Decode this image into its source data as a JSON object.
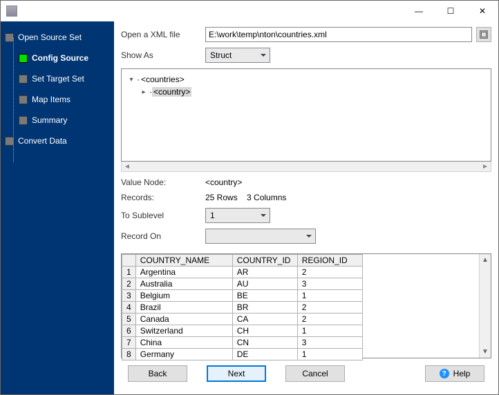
{
  "titlebar": {
    "min": "—",
    "max": "☐",
    "close": "✕"
  },
  "sidebar": {
    "items": [
      {
        "label": "Open Source Set"
      },
      {
        "label": "Config Source"
      },
      {
        "label": "Set Target Set"
      },
      {
        "label": "Map Items"
      },
      {
        "label": "Summary"
      },
      {
        "label": "Convert Data"
      }
    ]
  },
  "form": {
    "open_label": "Open a XML file",
    "path": "E:\\work\\temp\\nton\\countries.xml",
    "show_as_label": "Show As",
    "show_as_value": "Struct",
    "tree_root": "<countries>",
    "tree_child": "<country>",
    "value_node_label": "Value Node:",
    "value_node_value": "<country>",
    "records_label": "Records:",
    "records_value": "25 Rows    3 Columns",
    "sublevel_label": "To Sublevel",
    "sublevel_value": "1",
    "record_on_label": "Record On",
    "record_on_value": ""
  },
  "table": {
    "headers": [
      "COUNTRY_NAME",
      "COUNTRY_ID",
      "REGION_ID"
    ],
    "rows": [
      [
        "Argentina",
        "AR",
        "2"
      ],
      [
        "Australia",
        "AU",
        "3"
      ],
      [
        "Belgium",
        "BE",
        "1"
      ],
      [
        "Brazil",
        "BR",
        "2"
      ],
      [
        "Canada",
        "CA",
        "2"
      ],
      [
        "Switzerland",
        "CH",
        "1"
      ],
      [
        "China",
        "CN",
        "3"
      ],
      [
        "Germany",
        "DE",
        "1"
      ]
    ]
  },
  "footer": {
    "back": "Back",
    "next": "Next",
    "cancel": "Cancel",
    "help": "Help"
  }
}
